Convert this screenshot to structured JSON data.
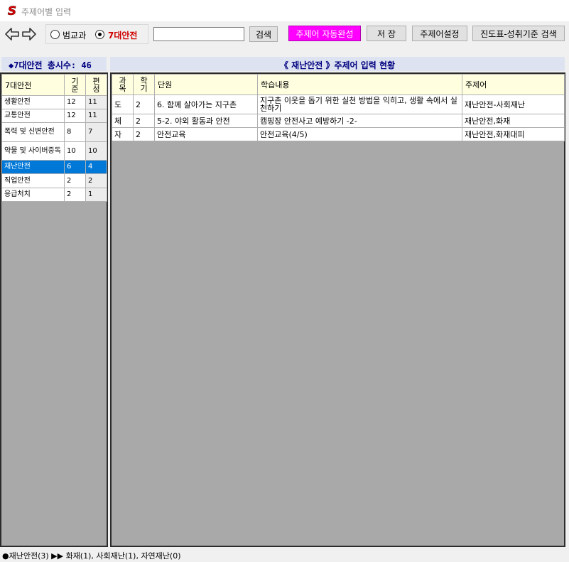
{
  "window": {
    "title": "주제어별 입력",
    "logo_letter": "S"
  },
  "toolbar": {
    "back_icon": "arrow-left-icon",
    "forward_icon": "arrow-right-icon",
    "radio_options": [
      {
        "label": "범교과",
        "checked": false
      },
      {
        "label": "7대안전",
        "checked": true
      }
    ],
    "search_value": "",
    "search_label": "검색",
    "autocomplete_label": "주제어 자동완성",
    "save_label": "저 장",
    "keyword_settings_label": "주제어설정",
    "progress_search_label": "진도표-성취기준 검색"
  },
  "left": {
    "header": "◆7대안전 총시수: 46",
    "columns": [
      "7대안전",
      "기준",
      "편성"
    ],
    "rows": [
      {
        "name": "생활안전",
        "base": "12",
        "plan": "11"
      },
      {
        "name": "교통안전",
        "base": "12",
        "plan": "11"
      },
      {
        "name": "폭력 및 신변안전",
        "base": "8",
        "plan": "7"
      },
      {
        "name": "약물 및 사이버중독",
        "base": "10",
        "plan": "10"
      },
      {
        "name": "재난안전",
        "base": "6",
        "plan": "4",
        "selected": true
      },
      {
        "name": "직업안전",
        "base": "2",
        "plan": "2"
      },
      {
        "name": "응급처치",
        "base": "2",
        "plan": "1"
      }
    ]
  },
  "right": {
    "header": "《 재난안전 》주제어 입력 현황",
    "columns": [
      "과목",
      "학기",
      "단원",
      "학습내용",
      "주제어"
    ],
    "rows": [
      {
        "subject": "도",
        "term": "2",
        "unit": "6. 함께 살아가는 지구촌",
        "content": "지구촌 이웃을 돕기 위한 실천 방법을 익히고, 생활 속에서 실천하기",
        "keyword": "재난안전-사회재난"
      },
      {
        "subject": "체",
        "term": "2",
        "unit": "5-2. 야외 활동과 안전",
        "content": "캠핑장 안전사고 예방하기 -2-",
        "keyword": "재난안전,화재"
      },
      {
        "subject": "자",
        "term": "2",
        "unit": "안전교육",
        "content": "안전교육(4/5)",
        "keyword": "재난안전,화재대피"
      }
    ]
  },
  "status": {
    "text": "●재난안전(3) ▶▶ 화재(1), 사회재난(1), 자연재난(0)"
  },
  "colors": {
    "selected_row": "#0078d7",
    "header_navy": "#000080",
    "magenta_button": "#ff00ff",
    "column_header": "#ffffe0",
    "panel_bg": "#a9a9a9"
  }
}
